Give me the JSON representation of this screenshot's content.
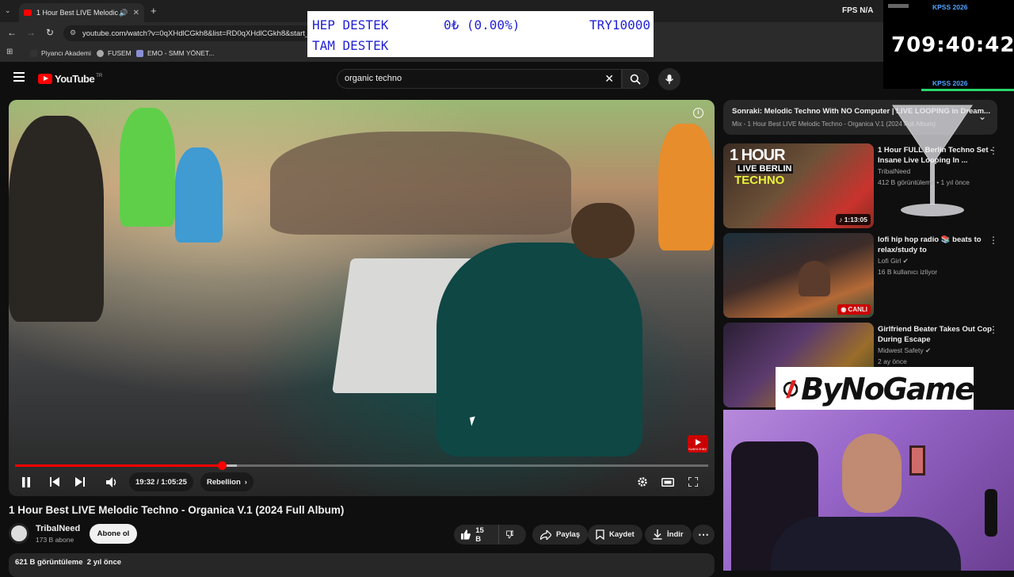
{
  "browser": {
    "tab_title": "1 Hour Best LIVE Melodic Te",
    "url": "youtube.com/watch?v=0qXHdlCGkh8&list=RD0qXHdlCGkh8&start_r",
    "bookmarks": [
      "Piyancı Akademi",
      "FUSEM",
      "EMO - SMM YÖNET..."
    ]
  },
  "overlay": {
    "donation_line1_left": "HEP DESTEK",
    "donation_line1_mid": "0₺ (0.00%)",
    "donation_line1_right": "TRY10000",
    "donation_line2": "TAM DESTEK",
    "fps_label": "FPS",
    "fps_value": "N/A",
    "kpss_top": "KPSS 2026",
    "kpss_bottom": "KPSS 2026",
    "countdown": "709:40:42",
    "sponsor": "ByNoGame"
  },
  "youtube": {
    "logo_text": "YouTube",
    "region": "TR",
    "search_value": "organic techno"
  },
  "player": {
    "time": "19:32 / 1:05:25",
    "chapter": "Rebellion",
    "progress_fraction": 0.2987,
    "buffered_fraction": 0.32,
    "subscribe_watermark": "SUBSCRIBE"
  },
  "video": {
    "title": "1 Hour Best LIVE Melodic Techno - Organica V.1 (2024 Full Album)",
    "channel": "TribalNeed",
    "subscribers": "173 B abone",
    "subscribe_label": "Abone ol",
    "likes": "15 B",
    "share_label": "Paylaş",
    "save_label": "Kaydet",
    "download_label": "İndir",
    "views_date": "621 B görüntüleme  2 yıl önce"
  },
  "sidebar": {
    "upnext_title": "Sonraki: Melodic Techno With NO Computer | LIVE LOOPING in Dream...",
    "upnext_sub": "Mix - 1 Hour Best LIVE Melodic Techno - Organica V.1 (2024 Full Album)",
    "items": [
      {
        "title": "1 Hour FULL Berlin Techno Set - Insane Live Looping In ...",
        "channel": "TribalNeed",
        "meta": "412 B görüntüleme • 1 yıl önce",
        "badge": "1:13:05",
        "thumb_text_1": "1 HOUR",
        "thumb_text_2": "LIVE BERLIN",
        "thumb_text_3": "TECHNO"
      },
      {
        "title": "lofi hip hop radio 📚 beats to relax/study to",
        "channel": "Lofi Girl",
        "meta": "16 B kullanıcı izliyor",
        "badge": "CANLI"
      },
      {
        "title": "Girlfriend Beater Takes Out Cop During Escape",
        "channel": "Midwest Safety",
        "meta": "2 ay önce",
        "badge": ""
      }
    ]
  },
  "colors": {
    "accent_red": "#ff0000",
    "bg": "#0f0f0f",
    "donation_text": "#2323d6",
    "kpss_blue": "#4fa3ff"
  }
}
